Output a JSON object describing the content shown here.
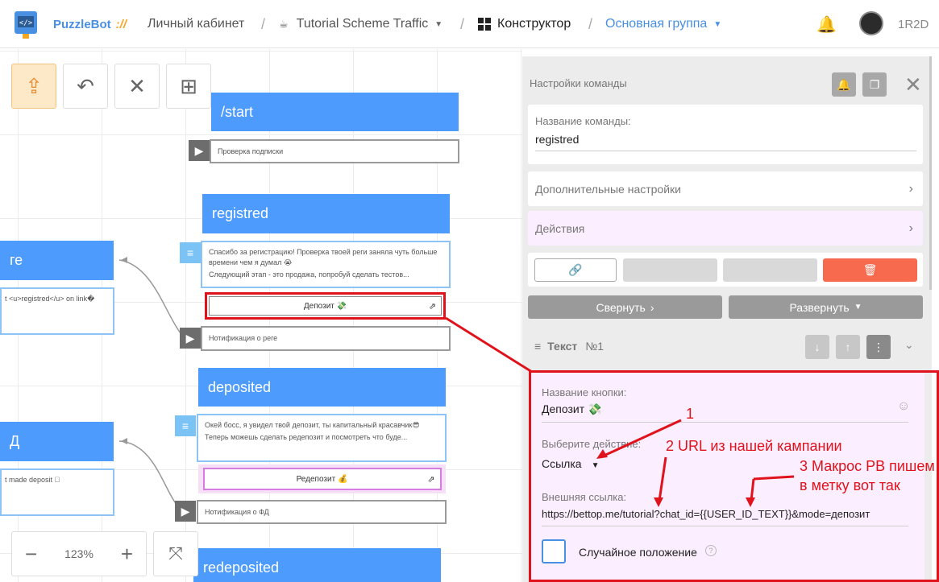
{
  "topbar": {
    "brand": "PuzzleBot",
    "brand_suffix": "://",
    "cabinet": "Личный кабинет",
    "project": "Tutorial Scheme Traffic",
    "constructor": "Конструктор",
    "group": "Основная группа",
    "user": "1R2D",
    "sep": "/"
  },
  "canvas": {
    "nodes": {
      "start_title": "/start",
      "start_link": "Проверка подписки",
      "registred_title": "registred",
      "registred_text1": "Спасибо за регистрацию! Проверка твоей реги заняла чуть больше времени чем я думал 😭",
      "registred_text2": "Следующий этап - это продажа, попробуй сделать тестов...",
      "registred_button": "Депозит 💸",
      "registred_link": "Нотификация о реге",
      "deposited_title": "deposited",
      "deposited_text1": "Окей босс, я увидел твой депозит, ты капитальный красавчик😎",
      "deposited_text2": "Теперь можешь сделать редепозит и посмотреть что буде...",
      "deposited_button": "Редепозит 💰",
      "deposited_link": "Нотификация о ФД",
      "redeposited_title": "redeposited",
      "left1_title": "ге",
      "left1_text": "t <u>registred</u> on link�",
      "left2_title": "Д",
      "left2_text": "t made deposit ⃞"
    },
    "zoom": "123%"
  },
  "panel": {
    "header": "Настройки команды",
    "cmd_name_label": "Название команды:",
    "cmd_name_value": "registred",
    "extra_settings": "Дополнительные настройки",
    "actions": "Действия",
    "collapse": "Свернуть",
    "expand": "Развернуть",
    "text_block_label": "Текст",
    "text_block_num": "№1",
    "button_name_label": "Название кнопки:",
    "button_name_value": "Депозит 💸",
    "action_label": "Выберите действие:",
    "action_value": "Ссылка",
    "url_label": "Внешняя ссылка:",
    "url_value": "https://bettop.me/tutorial?chat_id={{USER_ID_TEXT}}&mode=депозит",
    "random_label": "Случайное положение"
  },
  "annotations": {
    "a1": "1",
    "a2": "2 URL из нашей кампании",
    "a3_line1": "3 Макрос PB пишем",
    "a3_line2": "в метку вот так"
  },
  "colors": {
    "accent": "#4a90e2",
    "node": "#4d9bfd",
    "danger": "#f86a4e",
    "annotation": "#e0131c"
  }
}
